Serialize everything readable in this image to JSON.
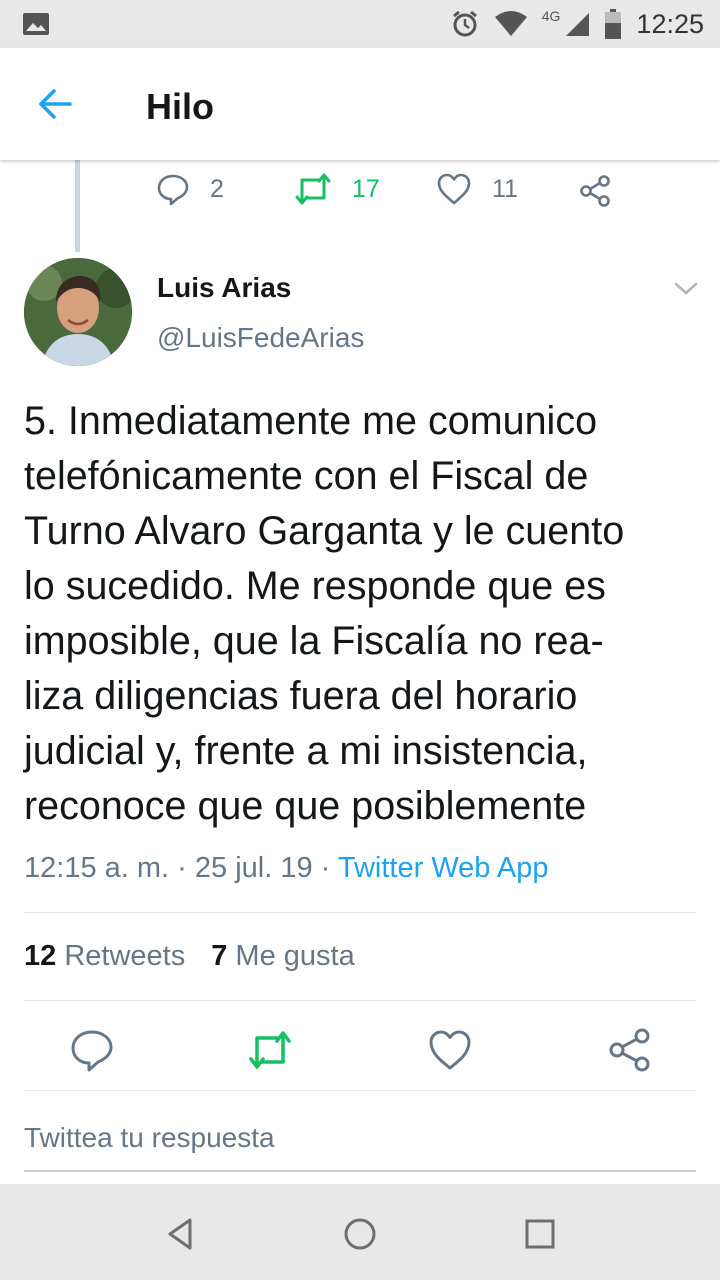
{
  "status_bar": {
    "network": "4G",
    "time": "12:25"
  },
  "header": {
    "back_icon": "arrow-left-icon",
    "title": "Hilo"
  },
  "prev_tweet_actions": {
    "replies": "2",
    "retweets": "17",
    "likes": "11"
  },
  "tweet": {
    "author_name": "Luis Arias",
    "author_handle": "@LuisFedeArias",
    "lines": [
      "5. Inmediatamente me comunico",
      "telefónicamente con el Fiscal de",
      "Turno Alvaro Garganta y le cuento",
      "lo sucedido. Me responde que es",
      "imposible, que la Fiscalía no rea-",
      "liza diligencias fuera del horario",
      "judicial y, frente a mi insistencia,",
      "reconoce que que posiblemente"
    ],
    "time": "12:15 a. m.",
    "date": "25 jul. 19",
    "separator": "·",
    "source": "Twitter Web App",
    "retweet_count": "12",
    "retweet_label": "Retweets",
    "like_count": "7",
    "like_label": "Me gusta"
  },
  "reply": {
    "placeholder": "Twittea tu respuesta"
  },
  "colors": {
    "accent_blue": "#1da1f2",
    "retweet_green": "#17bf63",
    "muted_gray": "#657786"
  }
}
